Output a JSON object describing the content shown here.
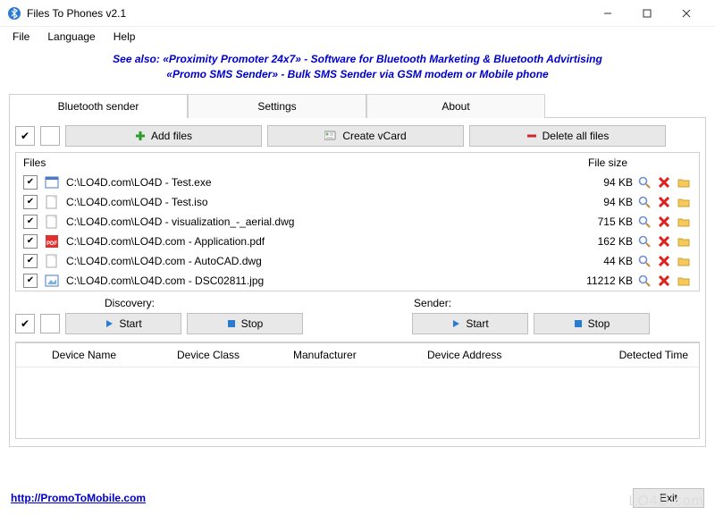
{
  "window": {
    "title": "Files To Phones v2.1"
  },
  "menu": {
    "file": "File",
    "language": "Language",
    "help": "Help"
  },
  "banner": {
    "line1": "See also: «Proximity Promoter 24x7» - Software for Bluetooth Marketing & Bluetooth Advirtising",
    "line2": "«Promo SMS Sender» - Bulk SMS Sender via GSM modem or Mobile phone"
  },
  "tabs": {
    "bluetooth": "Bluetooth sender",
    "settings": "Settings",
    "about": "About"
  },
  "toolbar": {
    "add_files": "Add files",
    "create_vcard": "Create vCard",
    "delete_all": "Delete all files"
  },
  "files_header": {
    "files": "Files",
    "size": "File size"
  },
  "files": [
    {
      "icon": "exe",
      "name": "C:\\LO4D.com\\LO4D - Test.exe",
      "size": "94 KB"
    },
    {
      "icon": "iso",
      "name": "C:\\LO4D.com\\LO4D - Test.iso",
      "size": "94 KB"
    },
    {
      "icon": "dwg",
      "name": "C:\\LO4D.com\\LO4D - visualization_-_aerial.dwg",
      "size": "715 KB"
    },
    {
      "icon": "pdf",
      "name": "C:\\LO4D.com\\LO4D.com - Application.pdf",
      "size": "162 KB"
    },
    {
      "icon": "dwg",
      "name": "C:\\LO4D.com\\LO4D.com - AutoCAD.dwg",
      "size": "44 KB"
    },
    {
      "icon": "jpg",
      "name": "C:\\LO4D.com\\LO4D.com - DSC02811.jpg",
      "size": "11212 KB"
    }
  ],
  "sections": {
    "discovery": "Discovery:",
    "sender": "Sender:",
    "start": "Start",
    "stop": "Stop"
  },
  "device_columns": {
    "name": "Device Name",
    "class": "Device Class",
    "manufacturer": "Manufacturer",
    "address": "Device Address",
    "detected": "Detected Time"
  },
  "footer": {
    "url": "http://PromoToMobile.com",
    "exit": "Exit"
  },
  "watermark": "LO4D.com"
}
